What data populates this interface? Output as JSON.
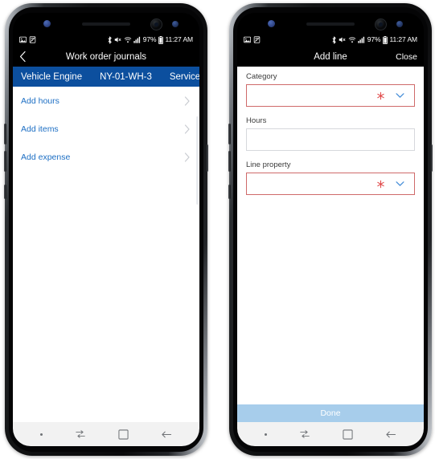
{
  "status_bar": {
    "battery_percent": "97%",
    "time": "11:27 AM",
    "icons": [
      "image-icon",
      "screenshot-icon",
      "bluetooth-icon",
      "mute-icon",
      "wifi-icon",
      "signal-icon",
      "battery-icon"
    ]
  },
  "left_phone": {
    "header": {
      "back_icon": "chevron-left-icon",
      "title": "Work order journals"
    },
    "breadcrumb": {
      "items": [
        "Vehicle Engine",
        "NY-01-WH-3",
        "Service"
      ],
      "background": "#0c4f9e"
    },
    "list": {
      "items": [
        {
          "label": "Add hours",
          "chevron": "chevron-right-icon"
        },
        {
          "label": "Add items",
          "chevron": "chevron-right-icon"
        },
        {
          "label": "Add expense",
          "chevron": "chevron-right-icon"
        }
      ],
      "link_color": "#1d6fc4"
    }
  },
  "right_phone": {
    "header": {
      "title": "Add line",
      "close_label": "Close"
    },
    "fields": [
      {
        "label": "Category",
        "value": "",
        "required": true,
        "required_icon": "asterisk-icon",
        "dropdown_icon": "chevron-down-icon",
        "border_color": "#cf6a6a"
      },
      {
        "label": "Hours",
        "value": "",
        "required": false,
        "required_icon": "",
        "dropdown_icon": "",
        "border_color": "#d6d8dc"
      },
      {
        "label": "Line property",
        "value": "",
        "required": true,
        "required_icon": "asterisk-icon",
        "dropdown_icon": "chevron-down-icon",
        "border_color": "#cf6a6a"
      }
    ],
    "done_button": {
      "label": "Done",
      "background": "#a7cdeb",
      "text_color": "#ffffff"
    }
  },
  "nav_bar": {
    "items": [
      "dot-indicator-icon",
      "switch-icon",
      "recents-square-icon",
      "back-arrow-icon"
    ]
  }
}
